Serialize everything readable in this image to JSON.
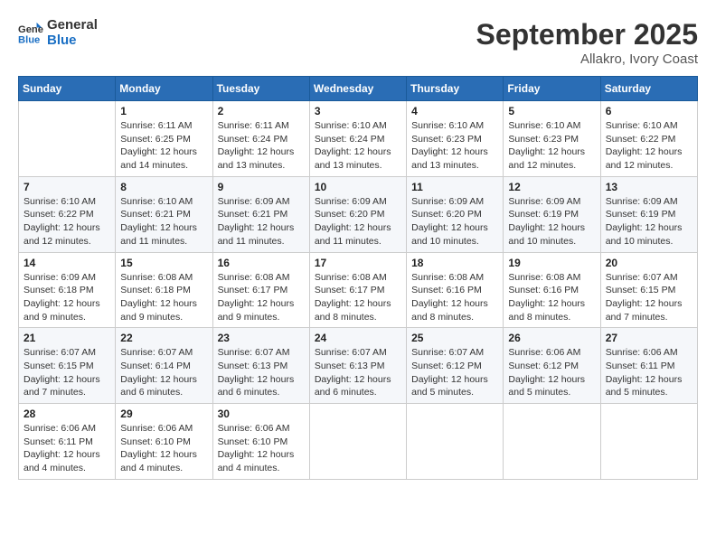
{
  "logo": {
    "line1": "General",
    "line2": "Blue"
  },
  "title": "September 2025",
  "location": "Allakro, Ivory Coast",
  "days_of_week": [
    "Sunday",
    "Monday",
    "Tuesday",
    "Wednesday",
    "Thursday",
    "Friday",
    "Saturday"
  ],
  "weeks": [
    [
      {
        "day": "",
        "sunrise": "",
        "sunset": "",
        "daylight": ""
      },
      {
        "day": "1",
        "sunrise": "Sunrise: 6:11 AM",
        "sunset": "Sunset: 6:25 PM",
        "daylight": "Daylight: 12 hours and 14 minutes."
      },
      {
        "day": "2",
        "sunrise": "Sunrise: 6:11 AM",
        "sunset": "Sunset: 6:24 PM",
        "daylight": "Daylight: 12 hours and 13 minutes."
      },
      {
        "day": "3",
        "sunrise": "Sunrise: 6:10 AM",
        "sunset": "Sunset: 6:24 PM",
        "daylight": "Daylight: 12 hours and 13 minutes."
      },
      {
        "day": "4",
        "sunrise": "Sunrise: 6:10 AM",
        "sunset": "Sunset: 6:23 PM",
        "daylight": "Daylight: 12 hours and 13 minutes."
      },
      {
        "day": "5",
        "sunrise": "Sunrise: 6:10 AM",
        "sunset": "Sunset: 6:23 PM",
        "daylight": "Daylight: 12 hours and 12 minutes."
      },
      {
        "day": "6",
        "sunrise": "Sunrise: 6:10 AM",
        "sunset": "Sunset: 6:22 PM",
        "daylight": "Daylight: 12 hours and 12 minutes."
      }
    ],
    [
      {
        "day": "7",
        "sunrise": "Sunrise: 6:10 AM",
        "sunset": "Sunset: 6:22 PM",
        "daylight": "Daylight: 12 hours and 12 minutes."
      },
      {
        "day": "8",
        "sunrise": "Sunrise: 6:10 AM",
        "sunset": "Sunset: 6:21 PM",
        "daylight": "Daylight: 12 hours and 11 minutes."
      },
      {
        "day": "9",
        "sunrise": "Sunrise: 6:09 AM",
        "sunset": "Sunset: 6:21 PM",
        "daylight": "Daylight: 12 hours and 11 minutes."
      },
      {
        "day": "10",
        "sunrise": "Sunrise: 6:09 AM",
        "sunset": "Sunset: 6:20 PM",
        "daylight": "Daylight: 12 hours and 11 minutes."
      },
      {
        "day": "11",
        "sunrise": "Sunrise: 6:09 AM",
        "sunset": "Sunset: 6:20 PM",
        "daylight": "Daylight: 12 hours and 10 minutes."
      },
      {
        "day": "12",
        "sunrise": "Sunrise: 6:09 AM",
        "sunset": "Sunset: 6:19 PM",
        "daylight": "Daylight: 12 hours and 10 minutes."
      },
      {
        "day": "13",
        "sunrise": "Sunrise: 6:09 AM",
        "sunset": "Sunset: 6:19 PM",
        "daylight": "Daylight: 12 hours and 10 minutes."
      }
    ],
    [
      {
        "day": "14",
        "sunrise": "Sunrise: 6:09 AM",
        "sunset": "Sunset: 6:18 PM",
        "daylight": "Daylight: 12 hours and 9 minutes."
      },
      {
        "day": "15",
        "sunrise": "Sunrise: 6:08 AM",
        "sunset": "Sunset: 6:18 PM",
        "daylight": "Daylight: 12 hours and 9 minutes."
      },
      {
        "day": "16",
        "sunrise": "Sunrise: 6:08 AM",
        "sunset": "Sunset: 6:17 PM",
        "daylight": "Daylight: 12 hours and 9 minutes."
      },
      {
        "day": "17",
        "sunrise": "Sunrise: 6:08 AM",
        "sunset": "Sunset: 6:17 PM",
        "daylight": "Daylight: 12 hours and 8 minutes."
      },
      {
        "day": "18",
        "sunrise": "Sunrise: 6:08 AM",
        "sunset": "Sunset: 6:16 PM",
        "daylight": "Daylight: 12 hours and 8 minutes."
      },
      {
        "day": "19",
        "sunrise": "Sunrise: 6:08 AM",
        "sunset": "Sunset: 6:16 PM",
        "daylight": "Daylight: 12 hours and 8 minutes."
      },
      {
        "day": "20",
        "sunrise": "Sunrise: 6:07 AM",
        "sunset": "Sunset: 6:15 PM",
        "daylight": "Daylight: 12 hours and 7 minutes."
      }
    ],
    [
      {
        "day": "21",
        "sunrise": "Sunrise: 6:07 AM",
        "sunset": "Sunset: 6:15 PM",
        "daylight": "Daylight: 12 hours and 7 minutes."
      },
      {
        "day": "22",
        "sunrise": "Sunrise: 6:07 AM",
        "sunset": "Sunset: 6:14 PM",
        "daylight": "Daylight: 12 hours and 6 minutes."
      },
      {
        "day": "23",
        "sunrise": "Sunrise: 6:07 AM",
        "sunset": "Sunset: 6:13 PM",
        "daylight": "Daylight: 12 hours and 6 minutes."
      },
      {
        "day": "24",
        "sunrise": "Sunrise: 6:07 AM",
        "sunset": "Sunset: 6:13 PM",
        "daylight": "Daylight: 12 hours and 6 minutes."
      },
      {
        "day": "25",
        "sunrise": "Sunrise: 6:07 AM",
        "sunset": "Sunset: 6:12 PM",
        "daylight": "Daylight: 12 hours and 5 minutes."
      },
      {
        "day": "26",
        "sunrise": "Sunrise: 6:06 AM",
        "sunset": "Sunset: 6:12 PM",
        "daylight": "Daylight: 12 hours and 5 minutes."
      },
      {
        "day": "27",
        "sunrise": "Sunrise: 6:06 AM",
        "sunset": "Sunset: 6:11 PM",
        "daylight": "Daylight: 12 hours and 5 minutes."
      }
    ],
    [
      {
        "day": "28",
        "sunrise": "Sunrise: 6:06 AM",
        "sunset": "Sunset: 6:11 PM",
        "daylight": "Daylight: 12 hours and 4 minutes."
      },
      {
        "day": "29",
        "sunrise": "Sunrise: 6:06 AM",
        "sunset": "Sunset: 6:10 PM",
        "daylight": "Daylight: 12 hours and 4 minutes."
      },
      {
        "day": "30",
        "sunrise": "Sunrise: 6:06 AM",
        "sunset": "Sunset: 6:10 PM",
        "daylight": "Daylight: 12 hours and 4 minutes."
      },
      {
        "day": "",
        "sunrise": "",
        "sunset": "",
        "daylight": ""
      },
      {
        "day": "",
        "sunrise": "",
        "sunset": "",
        "daylight": ""
      },
      {
        "day": "",
        "sunrise": "",
        "sunset": "",
        "daylight": ""
      },
      {
        "day": "",
        "sunrise": "",
        "sunset": "",
        "daylight": ""
      }
    ]
  ]
}
